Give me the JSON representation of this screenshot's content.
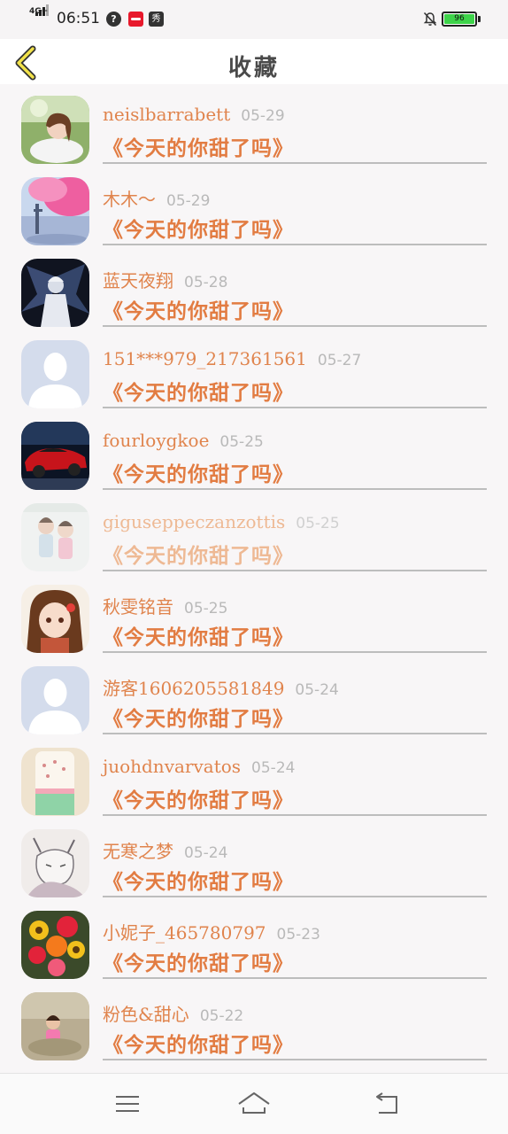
{
  "status_bar": {
    "network": "4G+",
    "time": "06:51",
    "battery": "96",
    "icons": [
      "help-circle-icon",
      "red-app-icon",
      "app-badge-icon",
      "notifications-off-icon",
      "battery-icon"
    ]
  },
  "header": {
    "title": "收藏",
    "back_icon": "chevron-left-icon"
  },
  "favorites": [
    {
      "user": "neislbarrabett",
      "date": "05-29",
      "title": "《今天的你甜了吗》",
      "avatar": "girl-photo"
    },
    {
      "user": "木木～",
      "date": "05-29",
      "title": "《今天的你甜了吗》",
      "avatar": "pink-tree-painting"
    },
    {
      "user": "蓝天夜翔",
      "date": "05-28",
      "title": "《今天的你甜了吗》",
      "avatar": "dark-angel-art"
    },
    {
      "user": "151***979_217361561",
      "date": "05-27",
      "title": "《今天的你甜了吗》",
      "avatar": "default-avatar"
    },
    {
      "user": "fourloygkoe",
      "date": "05-25",
      "title": "《今天的你甜了吗》",
      "avatar": "red-sports-car"
    },
    {
      "user": "giguseppeczanzottis",
      "date": "05-25",
      "title": "《今天的你甜了吗》",
      "avatar": "couple-photo",
      "faded": true
    },
    {
      "user": "秋雯铭音",
      "date": "05-25",
      "title": "《今天的你甜了吗》",
      "avatar": "anime-girl"
    },
    {
      "user": "游客1606205581849",
      "date": "05-24",
      "title": "《今天的你甜了吗》",
      "avatar": "default-avatar"
    },
    {
      "user": "juohdnvarvatos",
      "date": "05-24",
      "title": "《今天的你甜了吗》",
      "avatar": "phone-case"
    },
    {
      "user": "无寒之梦",
      "date": "05-24",
      "title": "《今天的你甜了吗》",
      "avatar": "anime-sketch"
    },
    {
      "user": "小妮子_465780797",
      "date": "05-23",
      "title": "《今天的你甜了吗》",
      "avatar": "flower-bouquet"
    },
    {
      "user": "粉色&甜心",
      "date": "05-22",
      "title": "《今天的你甜了吗》",
      "avatar": "child-in-pool"
    }
  ],
  "nav_bar": {
    "icons": [
      "menu-icon",
      "home-icon",
      "back-icon"
    ]
  },
  "colors": {
    "accent": "#e27c42",
    "date": "#b9b9b9",
    "title_text": "#4a4a4a",
    "background": "#f8f6f7"
  }
}
